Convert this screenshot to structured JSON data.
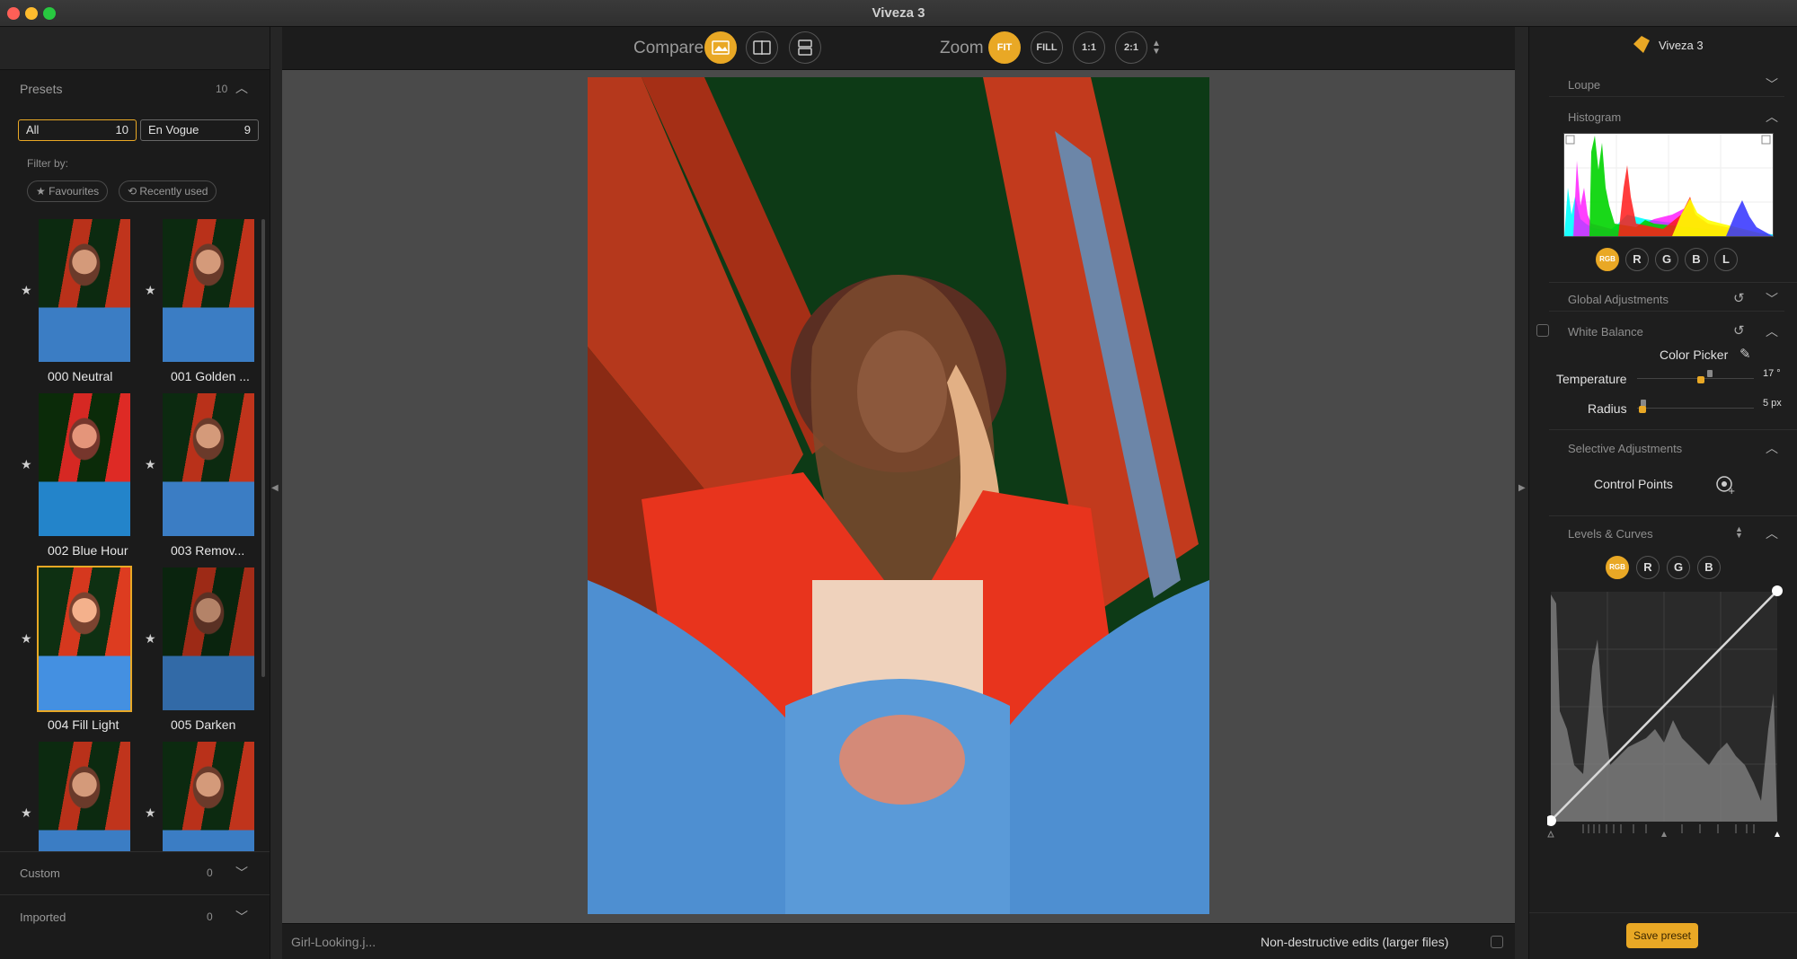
{
  "window": {
    "title": "Viveza 3",
    "traffic_colors": [
      "#fe5f57",
      "#febc2e",
      "#28c840"
    ]
  },
  "accent": "#e9a825",
  "presets": {
    "header": "Presets",
    "count": "10",
    "tabs": [
      {
        "label": "All",
        "count": "10"
      },
      {
        "label": "En Vogue",
        "count": "9"
      }
    ],
    "filter_label": "Filter by:",
    "filters": [
      "★ Favourites",
      "⟲ Recently used"
    ],
    "items": [
      {
        "label": "000 Neutral"
      },
      {
        "label": "001 Golden ..."
      },
      {
        "label": "002 Blue Hour"
      },
      {
        "label": "003 Remov..."
      },
      {
        "label": "004 Fill Light"
      },
      {
        "label": "005 Darken"
      },
      {
        "label": ""
      },
      {
        "label": ""
      }
    ],
    "custom": {
      "label": "Custom",
      "count": "0"
    },
    "imported": {
      "label": "Imported",
      "count": "0"
    }
  },
  "toolbar": {
    "compare_label": "Compare",
    "zoom_label": "Zoom",
    "zoom_buttons": [
      "FIT",
      "FILL",
      "1:1",
      "2:1"
    ]
  },
  "status": {
    "filename": "Girl-Looking.j...",
    "non_destructive": "Non-destructive edits (larger files)"
  },
  "right": {
    "brand": "Viveza 3",
    "loupe": "Loupe",
    "histogram": "Histogram",
    "channels": [
      "RGB",
      "R",
      "G",
      "B",
      "L"
    ],
    "global_adjustments": "Global Adjustments",
    "white_balance": "White Balance",
    "color_picker": "Color Picker",
    "temperature": {
      "label": "Temperature",
      "value": "17 °",
      "level": 0.55
    },
    "radius": {
      "label": "Radius",
      "value": "5 px",
      "level": 0.02
    },
    "selective_adjustments": "Selective Adjustments",
    "control_points": "Control Points",
    "levels_curves": "Levels & Curves",
    "curve_channels": [
      "RGB",
      "R",
      "G",
      "B"
    ],
    "save_preset": "Save preset"
  },
  "icons": {
    "compare_buttons": [
      "single-view-icon",
      "split-view-icon",
      "side-by-side-icon"
    ],
    "reset": "reset-icon",
    "eyedropper": "eyedropper-icon",
    "control_point": "control-point-icon"
  }
}
